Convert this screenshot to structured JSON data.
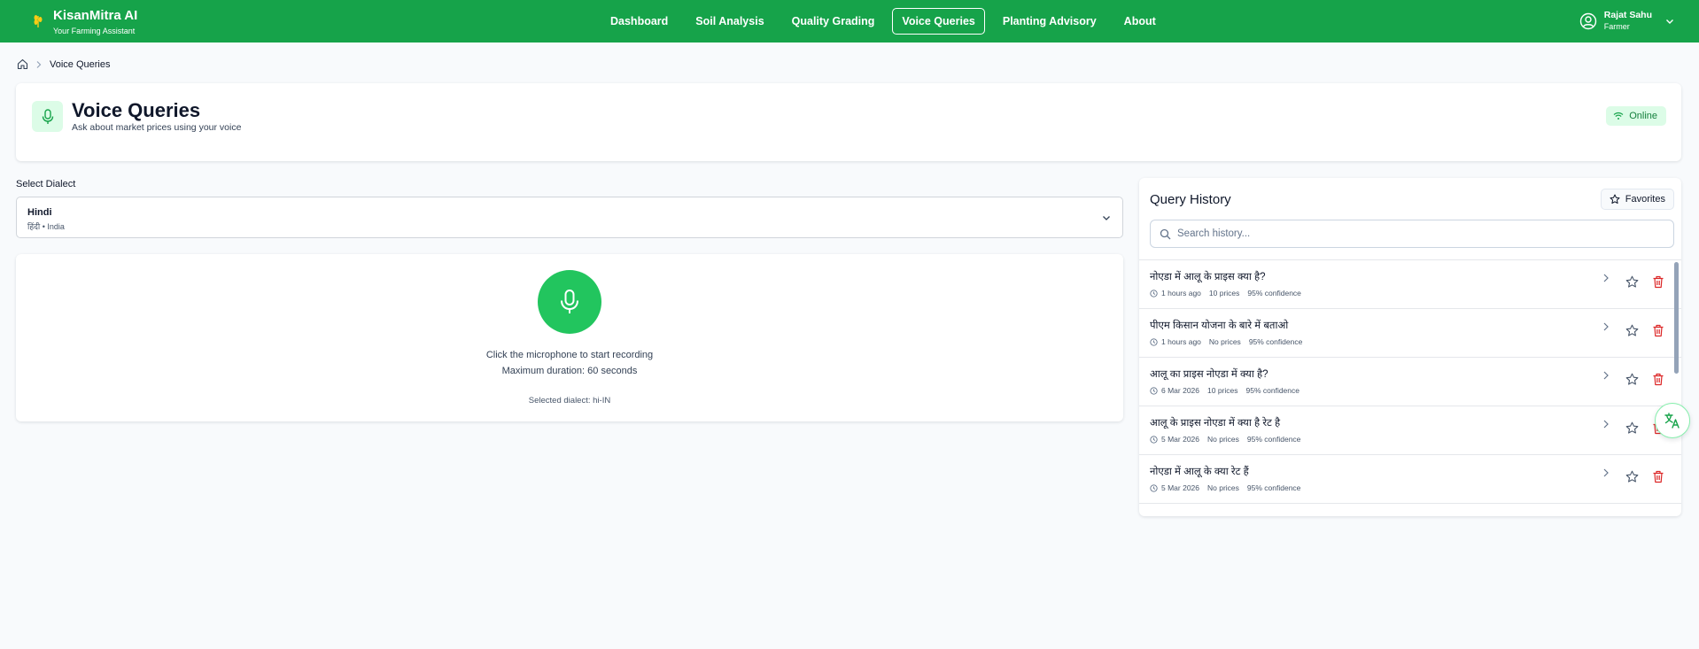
{
  "brand": {
    "title": "KisanMitra AI",
    "subtitle": "Your Farming Assistant",
    "icon": "wheat-icon"
  },
  "nav": {
    "items": [
      {
        "label": "Dashboard"
      },
      {
        "label": "Soil Analysis"
      },
      {
        "label": "Quality Grading"
      },
      {
        "label": "Voice Queries",
        "active": true
      },
      {
        "label": "Planting Advisory"
      },
      {
        "label": "About"
      }
    ]
  },
  "user": {
    "name": "Rajat Sahu",
    "role": "Farmer"
  },
  "breadcrumb": {
    "current": "Voice Queries"
  },
  "header": {
    "title": "Voice Queries",
    "subtitle": "Ask about market prices using your voice",
    "status": "Online"
  },
  "dialect": {
    "label": "Select Dialect",
    "name": "Hindi",
    "native": "हिंदी • India"
  },
  "recorder": {
    "hint": "Click the microphone to start recording",
    "max_duration": "Maximum duration: 60 seconds",
    "selected": "Selected dialect: hi-IN"
  },
  "history": {
    "title": "Query History",
    "favorites_label": "Favorites",
    "search_placeholder": "Search history...",
    "items": [
      {
        "query": "नोएडा में आलू के प्राइस क्या है?",
        "time": "1 hours ago",
        "prices": "10 prices",
        "confidence": "95% confidence"
      },
      {
        "query": "पीएम किसान योजना के बारे में बताओ",
        "time": "1 hours ago",
        "prices": "No prices",
        "confidence": "95% confidence"
      },
      {
        "query": "आलू का प्राइस नोएडा में क्या है?",
        "time": "6 Mar 2026",
        "prices": "10 prices",
        "confidence": "95% confidence"
      },
      {
        "query": "आलू के प्राइस नोएडा में क्या है रेट है",
        "time": "5 Mar 2026",
        "prices": "No prices",
        "confidence": "95% confidence"
      },
      {
        "query": "नोएडा में आलू के क्या रेट हैं",
        "time": "5 Mar 2026",
        "prices": "No prices",
        "confidence": "95% confidence"
      }
    ]
  },
  "colors": {
    "primary": "#16a34a",
    "accent": "#22c55e",
    "danger": "#dc2626"
  }
}
